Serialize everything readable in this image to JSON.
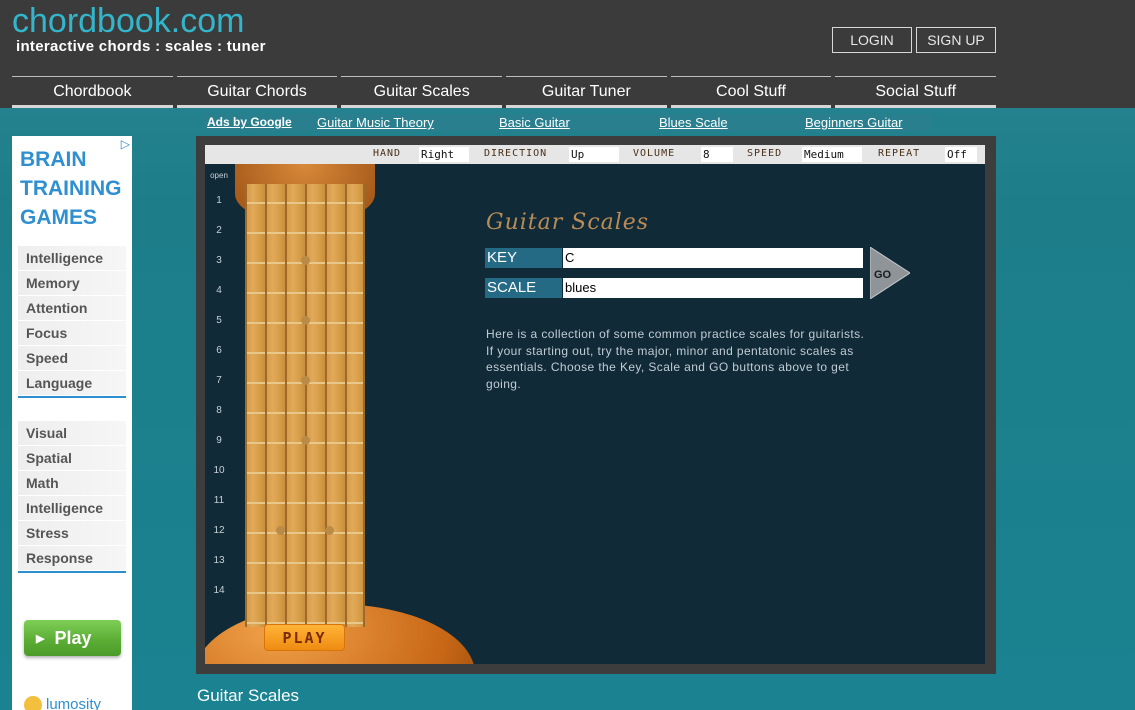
{
  "header": {
    "logo": "chordbook.com",
    "tagline": "interactive chords : scales : tuner",
    "login_label": "LOGIN",
    "signup_label": "SIGN UP"
  },
  "nav": {
    "items": [
      {
        "label": "Chordbook"
      },
      {
        "label": "Guitar Chords"
      },
      {
        "label": "Guitar Scales"
      },
      {
        "label": "Guitar Tuner"
      },
      {
        "label": "Cool Stuff"
      },
      {
        "label": "Social Stuff"
      }
    ]
  },
  "subnav": {
    "ads_label": "Ads by Google",
    "links": [
      "Guitar Music Theory",
      "Basic Guitar",
      "Blues Scale",
      "Beginners Guitar"
    ]
  },
  "left_ad": {
    "choice_icon": "ad-choices-icon",
    "title_lines": [
      "BRAIN",
      "TRAINING",
      "GAMES"
    ],
    "list_1": [
      "Intelligence",
      "Memory",
      "Attention",
      "Focus",
      "Speed",
      "Language"
    ],
    "list_2": [
      "Visual",
      "Spatial",
      "Math",
      "Intelligence",
      "Stress",
      "Response"
    ],
    "play_label": "Play",
    "brand": "lumosity"
  },
  "controls": {
    "hand_label": "HAND",
    "hand_value": "Right",
    "direction_label": "DIRECTION",
    "direction_value": "Up",
    "volume_label": "VOLUME",
    "volume_value": "8",
    "speed_label": "SPEED",
    "speed_value": "Medium",
    "repeat_label": "REPEAT",
    "repeat_value": "Off"
  },
  "neck": {
    "open_label": "open",
    "fret_numbers": [
      "1",
      "2",
      "3",
      "4",
      "5",
      "6",
      "7",
      "8",
      "9",
      "10",
      "11",
      "12",
      "13",
      "14"
    ],
    "play_label": "PLAY"
  },
  "panel": {
    "title": "Guitar Scales",
    "key_label": "KEY",
    "key_value": "C",
    "scale_label": "SCALE",
    "scale_value": "blues",
    "go_label": "GO",
    "description": "Here is a collection of some common practice scales for guitarists. If your starting out, try the major, minor and pentatonic scales as essentials. Choose the Key, Scale and GO buttons above to get going."
  },
  "page_heading": "Guitar Scales",
  "colors": {
    "brand": "#33b6cc",
    "header_bg": "#3b3b3b",
    "page_bg": "#1d7e8a",
    "app_bg": "#102a37",
    "ad_blue": "#2f8fd0",
    "play_orange": "#ef8b12"
  }
}
